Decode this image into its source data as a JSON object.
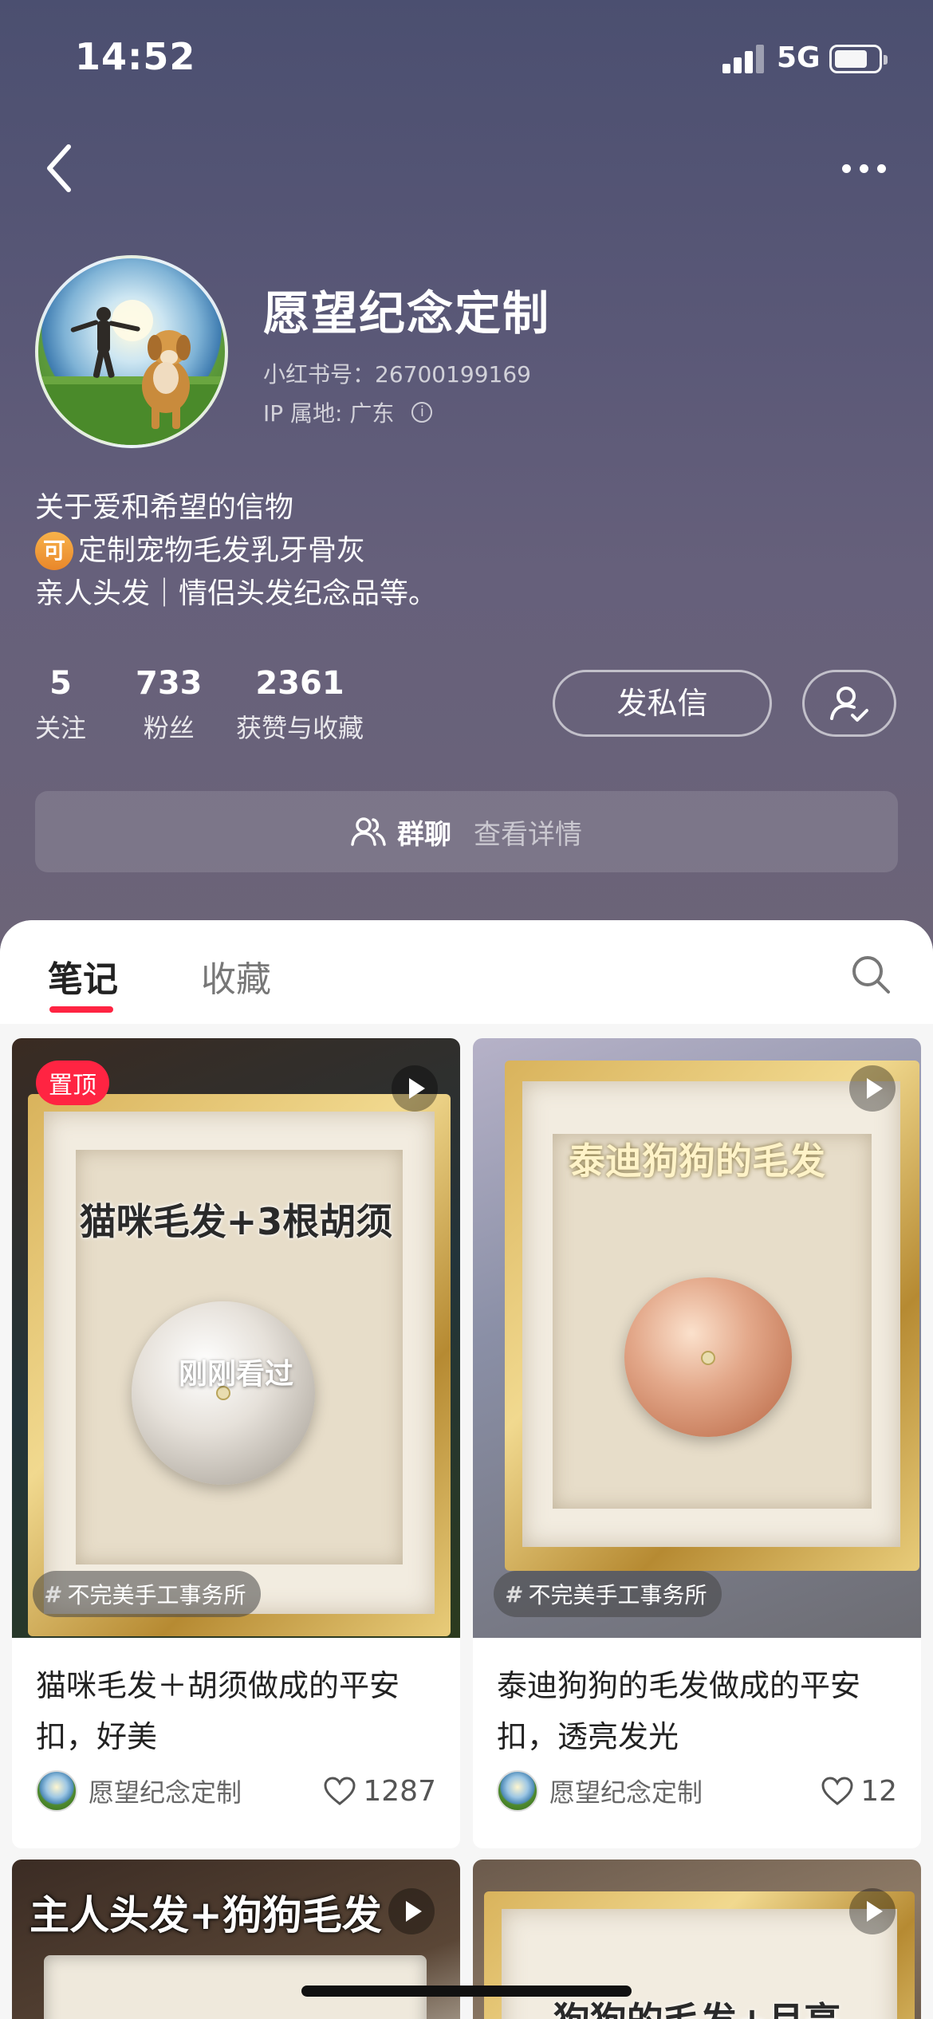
{
  "status_bar": {
    "time": "14:52",
    "network": "5G"
  },
  "profile": {
    "name": "愿望纪念定制",
    "id_label": "小红书号：26700199169",
    "ip_label": "IP 属地: 广东",
    "bio_lines": [
      "关于爱和希望的信物",
      "定制宠物毛发乳牙骨灰",
      "亲人头发｜情侣头发纪念品等。"
    ],
    "bio_badge": "可"
  },
  "stats": [
    {
      "value": "5",
      "label": "关注"
    },
    {
      "value": "733",
      "label": "粉丝"
    },
    {
      "value": "2361",
      "label": "获赞与收藏"
    }
  ],
  "actions": {
    "message_label": "发私信"
  },
  "group_chat": {
    "label": "群聊",
    "detail": "查看详情"
  },
  "tabs": {
    "notes": "笔记",
    "collections": "收藏"
  },
  "notes": [
    {
      "pinned_label": "置顶",
      "overlay_text": "猫咪毛发+3根胡须",
      "seen_label": "刚刚看过",
      "topic": "不完美手工事务所",
      "title": "猫咪毛发＋胡须做成的平安扣，好美",
      "author": "愿望纪念定制",
      "likes": "1287"
    },
    {
      "overlay_text": "泰迪狗狗的毛发",
      "topic": "不完美手工事务所",
      "title": "泰迪狗狗的毛发做成的平安扣，透亮发光",
      "author": "愿望纪念定制",
      "likes": "12"
    },
    {
      "overlay_text": "主人头发+狗狗毛发"
    },
    {
      "overlay_text": "狗狗的毛发+月亮"
    }
  ],
  "colors": {
    "accent": "#ff2442",
    "header_top": "#4b4f70",
    "header_bottom": "#6c6478"
  }
}
